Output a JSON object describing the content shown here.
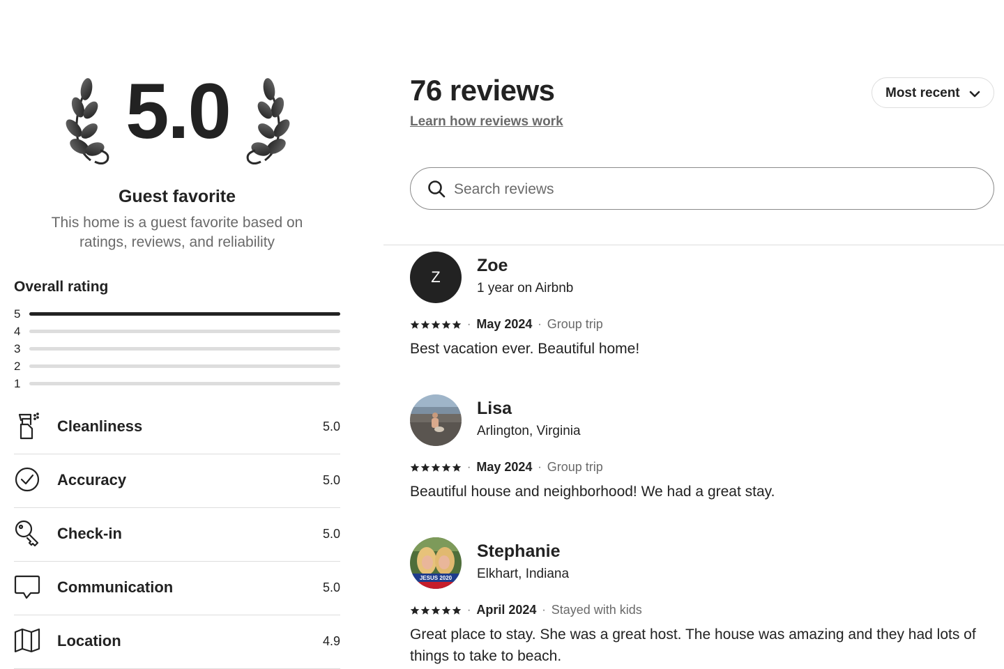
{
  "summary": {
    "overall_score": "5.0",
    "badge_title": "Guest favorite",
    "badge_description": "This home is a guest favorite based on ratings, reviews, and reliability",
    "overall_rating_label": "Overall rating",
    "distribution": [
      {
        "stars": "5",
        "fraction": 1.0
      },
      {
        "stars": "4",
        "fraction": 0
      },
      {
        "stars": "3",
        "fraction": 0
      },
      {
        "stars": "2",
        "fraction": 0
      },
      {
        "stars": "1",
        "fraction": 0
      }
    ],
    "categories": [
      {
        "label": "Cleanliness",
        "score": "5.0",
        "icon": "spray-bottle-icon"
      },
      {
        "label": "Accuracy",
        "score": "5.0",
        "icon": "check-circle-icon"
      },
      {
        "label": "Check-in",
        "score": "5.0",
        "icon": "key-icon"
      },
      {
        "label": "Communication",
        "score": "5.0",
        "icon": "chat-bubble-icon"
      },
      {
        "label": "Location",
        "score": "4.9",
        "icon": "map-icon"
      }
    ]
  },
  "reviews_header": {
    "count_title": "76 reviews",
    "learn_link": "Learn how reviews work",
    "sort_label": "Most recent",
    "search_placeholder": "Search reviews"
  },
  "reviews": [
    {
      "name": "Zoe",
      "subtitle": "1 year on Airbnb",
      "avatar_initial": "Z",
      "rating": 5,
      "date": "May 2024",
      "trip_type": "Group trip",
      "text": "Best vacation ever. Beautiful home!"
    },
    {
      "name": "Lisa",
      "subtitle": "Arlington, Virginia",
      "avatar_initial": "",
      "rating": 5,
      "date": "May 2024",
      "trip_type": "Group trip",
      "text": "Beautiful house and neighborhood! We had a great stay."
    },
    {
      "name": "Stephanie",
      "subtitle": "Elkhart, Indiana",
      "avatar_initial": "",
      "avatar_badge_text": "JESUS 2020",
      "rating": 5,
      "date": "April 2024",
      "trip_type": "Stayed with kids",
      "text": "Great place to stay. She was a great host. The house was amazing and they had lots of things to take to beach."
    }
  ],
  "colors": {
    "text": "#222222",
    "muted": "#6a6a6a",
    "divider": "#dddddd",
    "bar_fill": "#222222",
    "bar_track": "#dddddd"
  }
}
